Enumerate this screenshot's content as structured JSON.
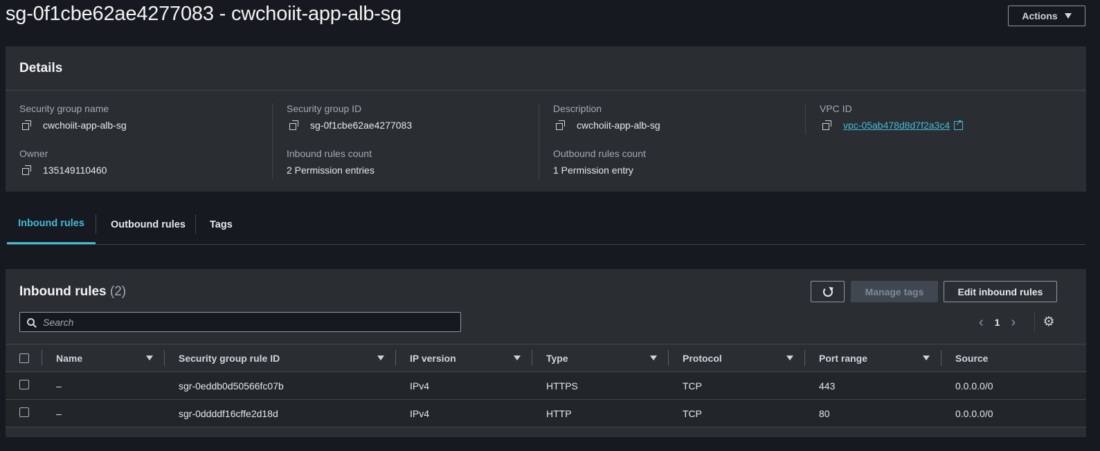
{
  "page": {
    "title": "sg-0f1cbe62ae4277083 - cwchoiit-app-alb-sg",
    "actions_label": "Actions"
  },
  "details": {
    "header": "Details",
    "security_group_name": {
      "label": "Security group name",
      "value": "cwchoiit-app-alb-sg"
    },
    "security_group_id": {
      "label": "Security group ID",
      "value": "sg-0f1cbe62ae4277083"
    },
    "description": {
      "label": "Description",
      "value": "cwchoiit-app-alb-sg"
    },
    "vpc_id": {
      "label": "VPC ID",
      "value": "vpc-05ab478d8d7f2a3c4"
    },
    "owner": {
      "label": "Owner",
      "value": "135149110460"
    },
    "inbound_count": {
      "label": "Inbound rules count",
      "value": "2 Permission entries"
    },
    "outbound_count": {
      "label": "Outbound rules count",
      "value": "1 Permission entry"
    }
  },
  "tabs": [
    {
      "label": "Inbound rules",
      "active": true
    },
    {
      "label": "Outbound rules",
      "active": false
    },
    {
      "label": "Tags",
      "active": false
    }
  ],
  "rules": {
    "title": "Inbound rules",
    "count": "(2)",
    "manage_tags_label": "Manage tags",
    "edit_label": "Edit inbound rules",
    "search_placeholder": "Search",
    "page": "1",
    "columns": [
      "Name",
      "Security group rule ID",
      "IP version",
      "Type",
      "Protocol",
      "Port range",
      "Source"
    ],
    "rows": [
      {
        "name": "–",
        "rule_id": "sgr-0eddb0d50566fc07b",
        "ip_version": "IPv4",
        "type": "HTTPS",
        "protocol": "TCP",
        "port_range": "443",
        "source": "0.0.0.0/0"
      },
      {
        "name": "–",
        "rule_id": "sgr-0ddddf16cffe2d18d",
        "ip_version": "IPv4",
        "type": "HTTP",
        "protocol": "TCP",
        "port_range": "80",
        "source": "0.0.0.0/0"
      }
    ]
  },
  "colors": {
    "accent": "#44b9d6",
    "background": "#16191f",
    "panel": "#2a2e33"
  }
}
